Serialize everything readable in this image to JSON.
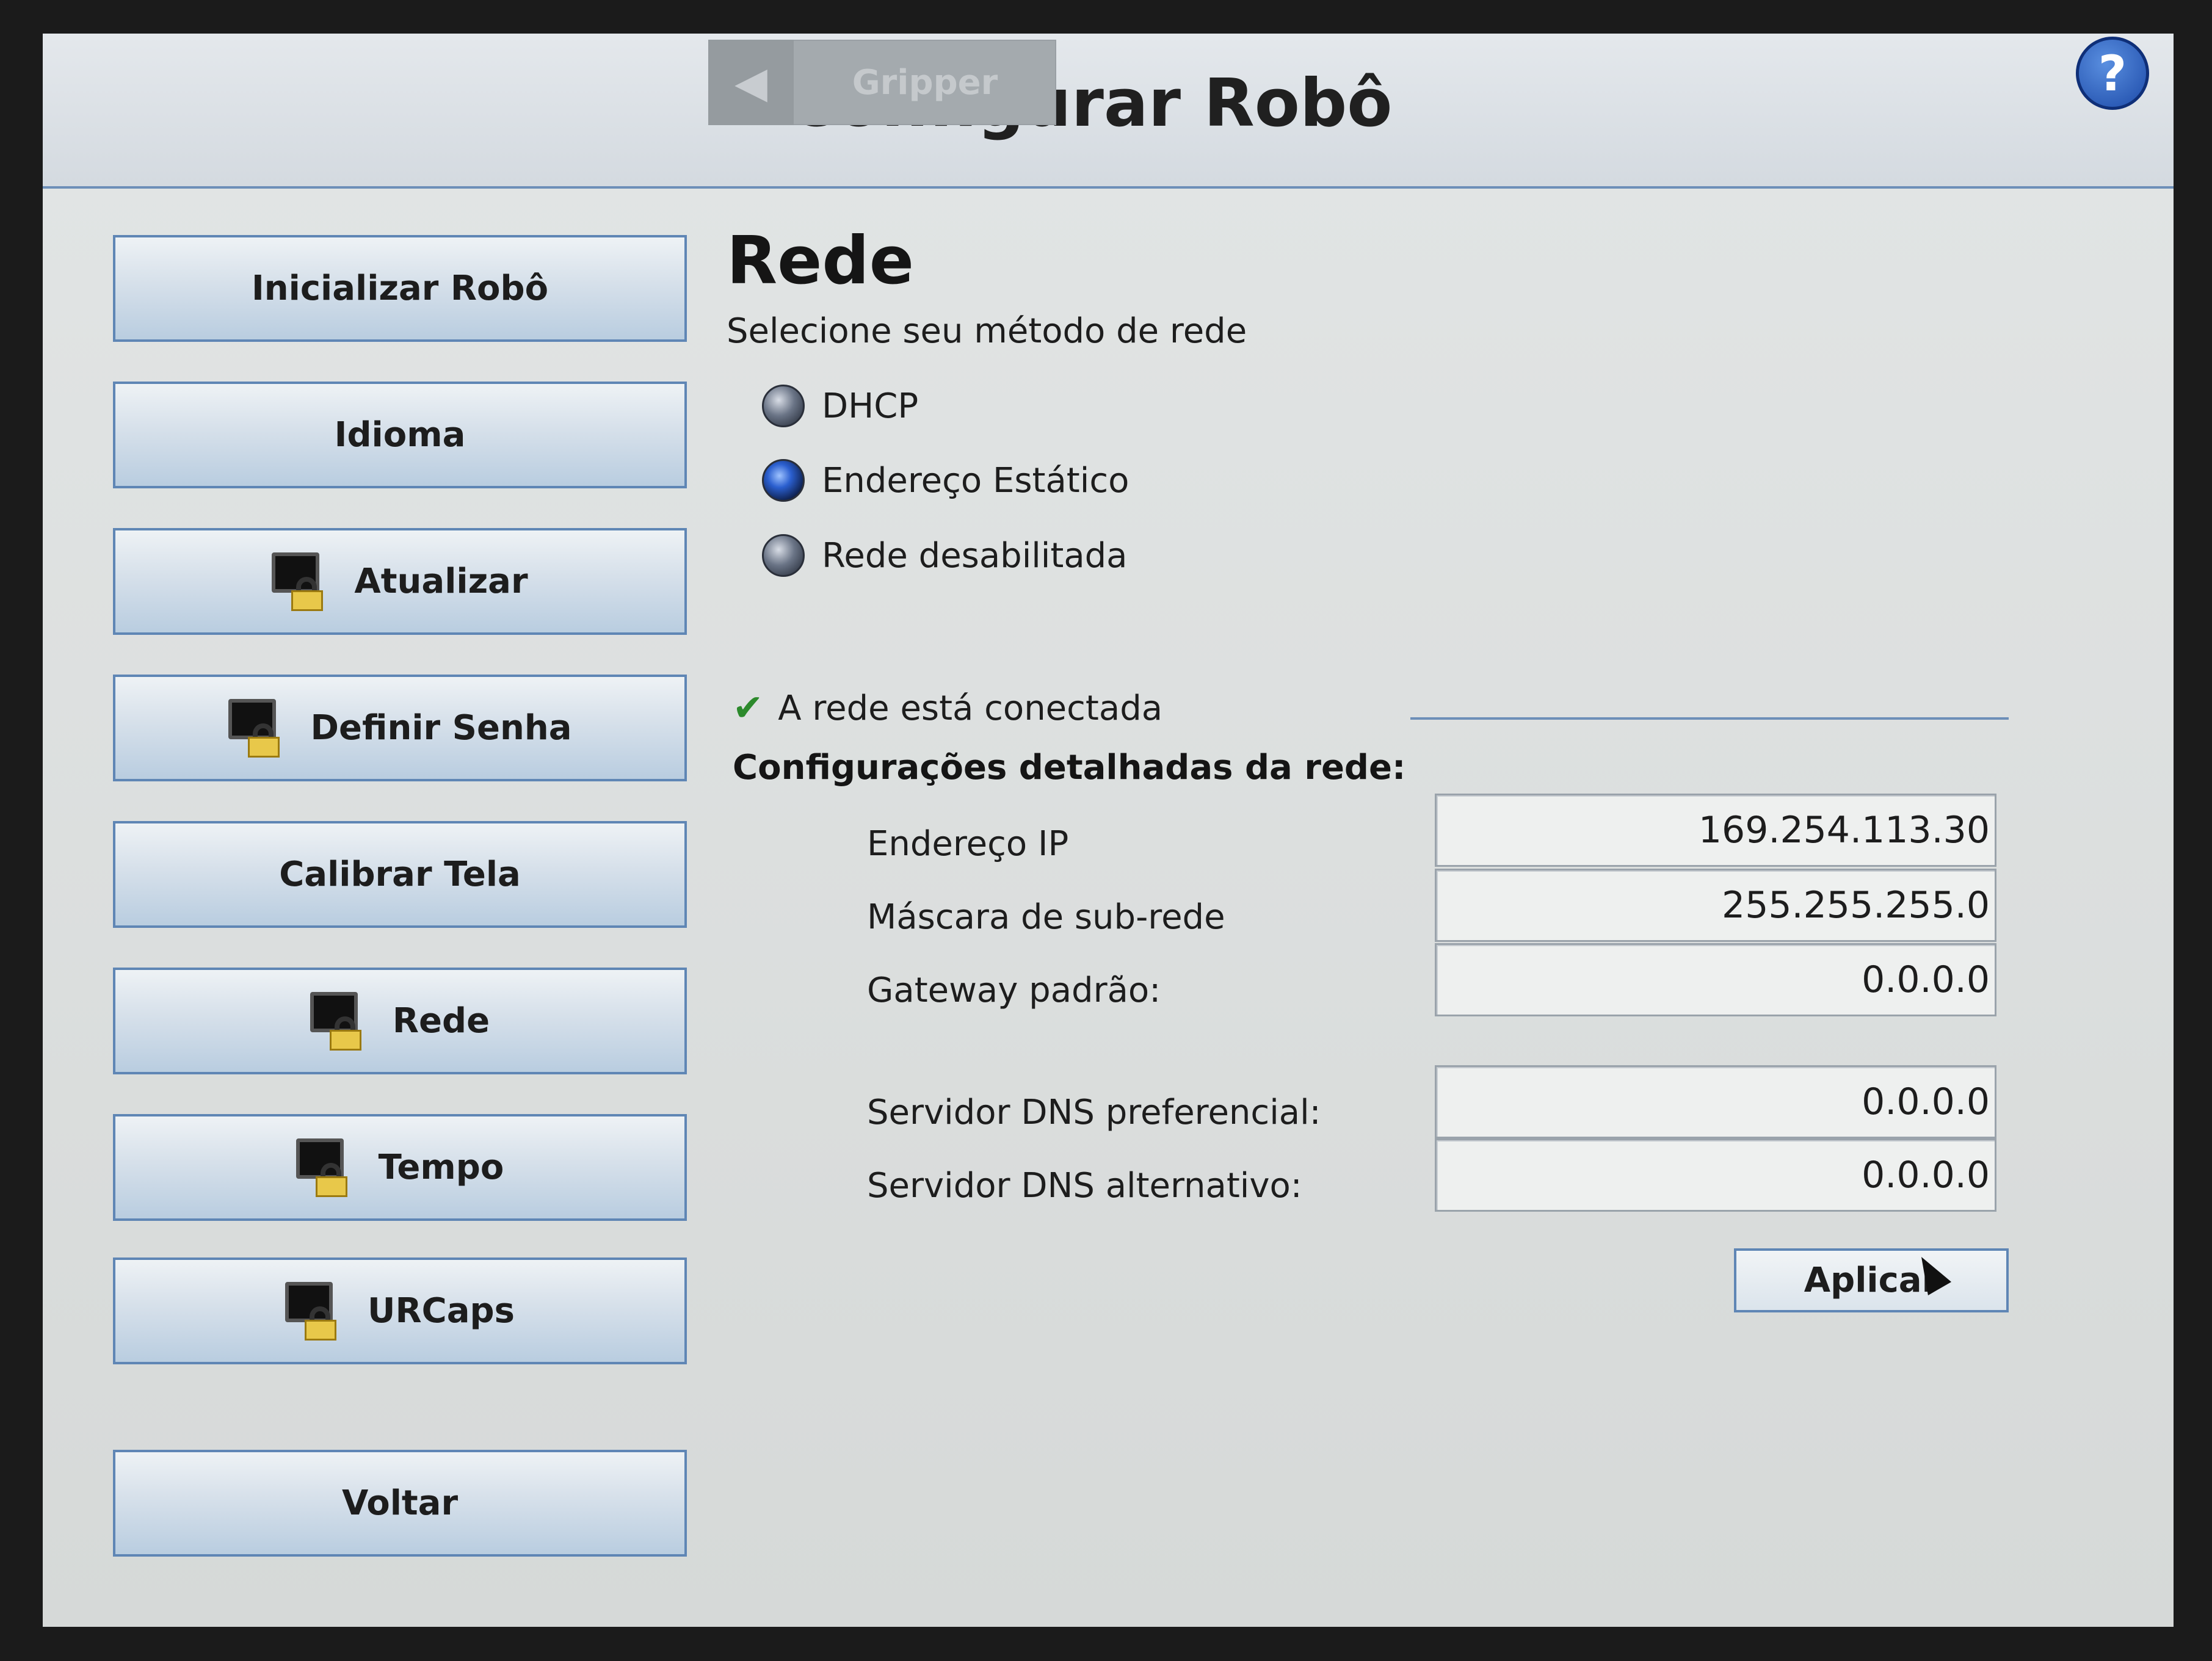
{
  "header": {
    "title": "Configurar Robô",
    "gripper_tab_label": "Gripper",
    "back_arrow": "◀",
    "help_symbol": "?"
  },
  "sidebar": {
    "items": [
      {
        "label": "Inicializar Robô",
        "locked": false
      },
      {
        "label": "Idioma",
        "locked": false
      },
      {
        "label": "Atualizar",
        "locked": true
      },
      {
        "label": "Definir Senha",
        "locked": true
      },
      {
        "label": "Calibrar Tela",
        "locked": false
      },
      {
        "label": "Rede",
        "locked": true
      },
      {
        "label": "Tempo",
        "locked": true
      },
      {
        "label": "URCaps",
        "locked": true
      }
    ],
    "back_label": "Voltar"
  },
  "network": {
    "title": "Rede",
    "subtitle": "Selecione seu método de rede",
    "options": [
      {
        "label": "DHCP",
        "selected": false
      },
      {
        "label": "Endereço Estático",
        "selected": true
      },
      {
        "label": "Rede desabilitada",
        "selected": false
      }
    ],
    "status_text": "A rede está conectada",
    "details_title": "Configurações detalhadas da rede:",
    "fields": {
      "ip_label": "Endereço IP",
      "ip_value": "169.254.113.30",
      "mask_label": "Máscara de sub-rede",
      "mask_value": "255.255.255.0",
      "gateway_label": "Gateway padrão:",
      "gateway_value": "0.0.0.0",
      "dns1_label": "Servidor DNS preferencial:",
      "dns1_value": "0.0.0.0",
      "dns2_label": "Servidor DNS alternativo:",
      "dns2_value": "0.0.0.0"
    },
    "apply_label": "Aplicar"
  },
  "colors": {
    "accent": "#5f86b5",
    "status_ok": "#2c8a2c",
    "help": "#1c4aa8"
  }
}
